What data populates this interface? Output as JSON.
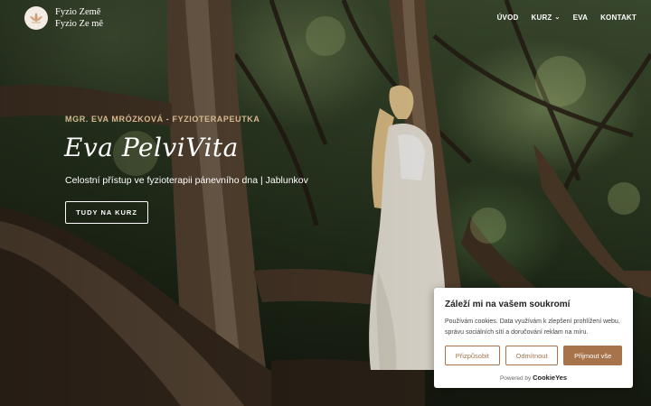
{
  "header": {
    "logo_line1": "Fyzio Země",
    "logo_line2": "Fyzio Ze mě",
    "nav": [
      {
        "label": "ÚVOD"
      },
      {
        "label": "KURZ",
        "has_dropdown": true
      },
      {
        "label": "EVA"
      },
      {
        "label": "KONTAKT"
      }
    ]
  },
  "hero": {
    "eyebrow": "MGR. EVA MRÓZKOVÁ - FYZIOTERAPEUTKA",
    "title": "Eva PelviVita",
    "subtitle": "Celostní přístup ve fyzioterapii pánevního dna | Jablunkov",
    "button": "TUDY NA KURZ"
  },
  "cookie": {
    "title": "Záleží mi na vašem soukromí",
    "text": "Používám cookies. Data využívám k zlepšení prohlížení webu, správu sociálních sítí a doručování reklam na míru.",
    "customize": "Přizpůsobit",
    "reject": "Odmítnout",
    "accept": "Přijmout vše",
    "powered_by": "Powered by",
    "brand": "CookieYes"
  },
  "colors": {
    "accent": "#a7734a",
    "eyebrow": "#d8b98f"
  }
}
